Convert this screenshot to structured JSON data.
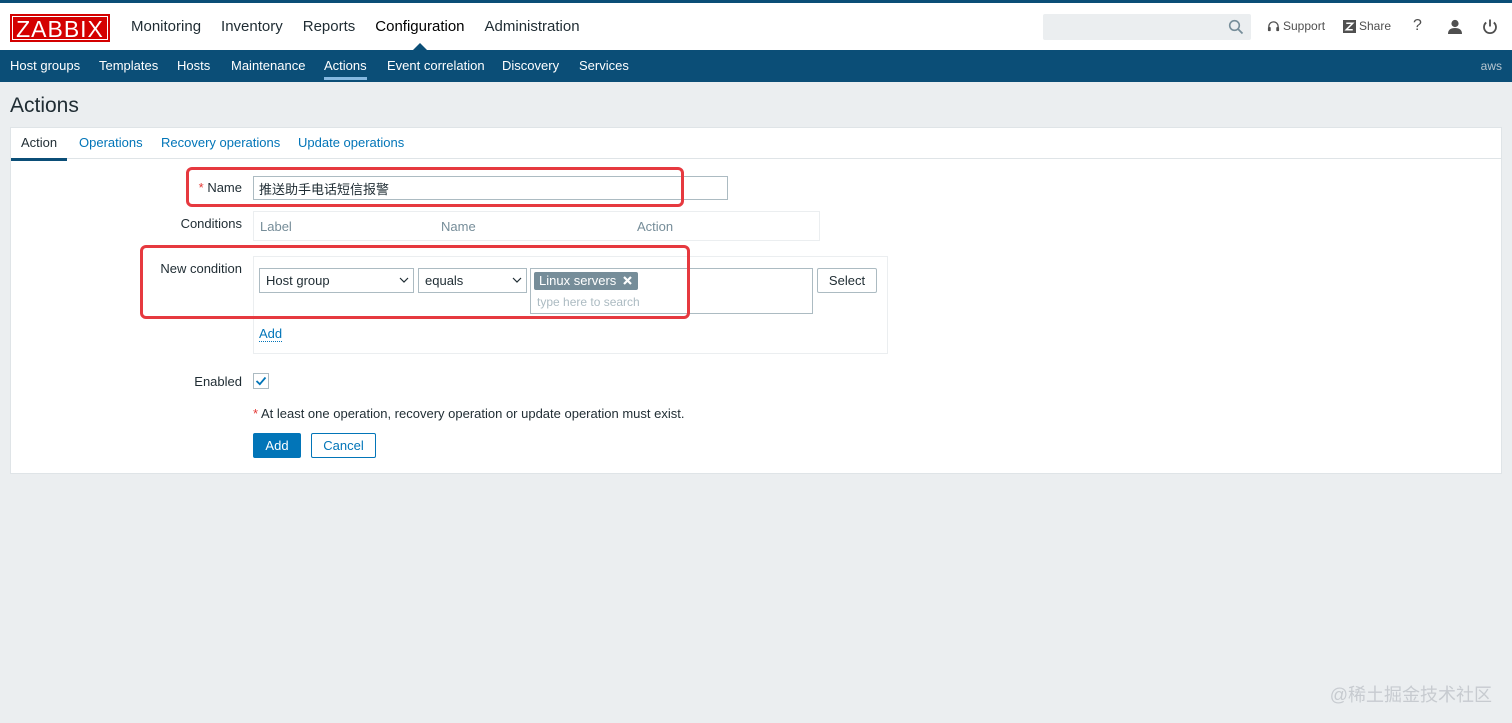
{
  "brand": {
    "logo": "ZABBIX"
  },
  "main_menu": [
    {
      "label": "Monitoring",
      "active": false
    },
    {
      "label": "Inventory",
      "active": false
    },
    {
      "label": "Reports",
      "active": false
    },
    {
      "label": "Configuration",
      "active": true
    },
    {
      "label": "Administration",
      "active": false
    }
  ],
  "header_tools": {
    "search_placeholder": "",
    "support": "Support",
    "share": "Share",
    "help": "?"
  },
  "sub_menu": [
    {
      "label": "Host groups",
      "active": false
    },
    {
      "label": "Templates",
      "active": false
    },
    {
      "label": "Hosts",
      "active": false
    },
    {
      "label": "Maintenance",
      "active": false
    },
    {
      "label": "Actions",
      "active": true
    },
    {
      "label": "Event correlation",
      "active": false
    },
    {
      "label": "Discovery",
      "active": false
    },
    {
      "label": "Services",
      "active": false
    }
  ],
  "server_name": "aws",
  "page_title": "Actions",
  "tabs": [
    {
      "label": "Action",
      "active": true
    },
    {
      "label": "Operations",
      "active": false
    },
    {
      "label": "Recovery operations",
      "active": false
    },
    {
      "label": "Update operations",
      "active": false
    }
  ],
  "form": {
    "name_label": "Name",
    "required_mark": "*",
    "name_value": "推送助手电话短信报警",
    "conditions_label": "Conditions",
    "conditions_columns": [
      "Label",
      "Name",
      "Action"
    ],
    "new_condition_label": "New condition",
    "condition_type": "Host group",
    "condition_operator": "equals",
    "selected_values": [
      "Linux servers"
    ],
    "multiselect_placeholder": "type here to search",
    "select_button": "Select",
    "add_link": "Add",
    "enabled_label": "Enabled",
    "enabled": true,
    "note": "At least one operation, recovery operation or update operation must exist.",
    "add_button": "Add",
    "cancel_button": "Cancel"
  },
  "watermark": "@稀土掘金技术社区",
  "colors": {
    "brand_red": "#d40000",
    "nav_blue": "#0b4e77",
    "link_blue": "#0275b8",
    "highlight_red": "#e6393f"
  },
  "icons": [
    "search-icon",
    "headset-icon",
    "share-icon",
    "help-icon",
    "user-icon",
    "power-icon",
    "chevron-down-icon",
    "remove-icon",
    "checkmark-icon"
  ]
}
